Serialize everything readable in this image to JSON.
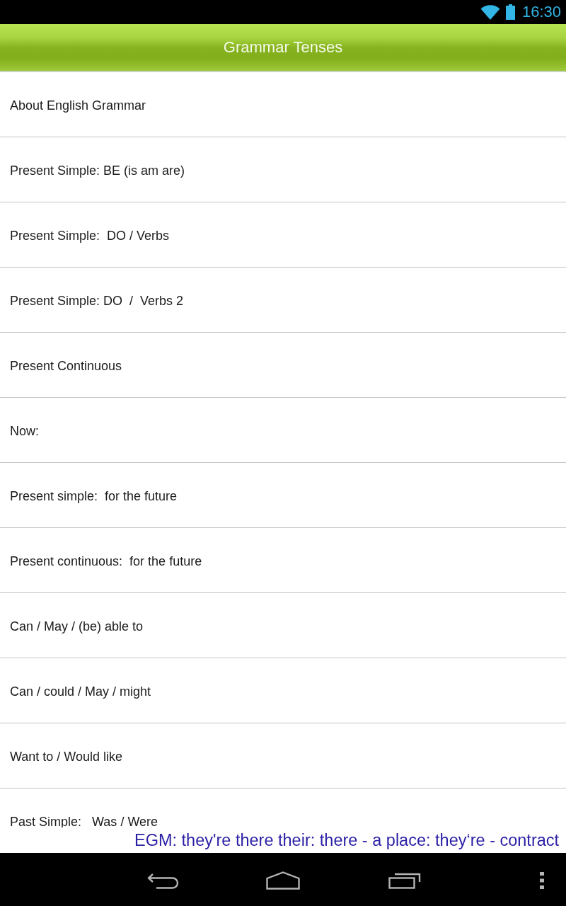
{
  "status_bar": {
    "time": "16:30"
  },
  "action_bar": {
    "title": "Grammar Tenses"
  },
  "topics": [
    {
      "label": "About English Grammar"
    },
    {
      "label": "Present Simple: BE (is am are)"
    },
    {
      "label": "Present Simple:  DO / Verbs"
    },
    {
      "label": "Present Simple: DO  /  Verbs 2"
    },
    {
      "label": "Present Continuous"
    },
    {
      "label": "Now:"
    },
    {
      "label": "Present simple:  for the future"
    },
    {
      "label": "Present continuous:  for the future"
    },
    {
      "label": "Can / May / (be) able to"
    },
    {
      "label": "Can / could / May / might"
    },
    {
      "label": "Want to / Would like"
    },
    {
      "label": "Past Simple:   Was / Were"
    }
  ],
  "ticker": {
    "text": "EGM: they're there their: there - a place: they‘re - contract"
  }
}
